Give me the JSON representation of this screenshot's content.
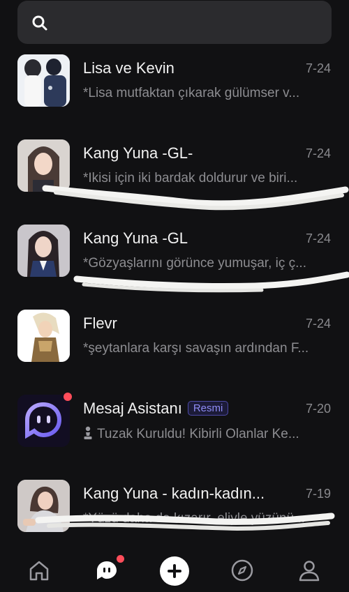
{
  "search": {
    "icon": "search-icon"
  },
  "conversations": [
    {
      "name": "Lisa ve Kevin",
      "date": "7-24",
      "preview": "*Lisa mutfaktan çıkarak gülümser v..."
    },
    {
      "name": "Kang Yuna -GL-",
      "date": "7-24",
      "preview": "*Ikisi için iki bardak doldurur ve biri..."
    },
    {
      "name": "Kang Yuna -GL",
      "date": "7-24",
      "preview": "*Gözyaşlarını görünce yumuşar, iç ç..."
    },
    {
      "name": "Flevr",
      "date": "7-24",
      "preview": "*şeytanlara karşı savaşın ardından F..."
    },
    {
      "name": "Mesaj Asistanı",
      "badge": "Resmi",
      "date": "7-20",
      "preview_icon": "chess-pawn-icon",
      "preview": "Tuzak Kuruldu! Kibirli Olanlar Ke..."
    },
    {
      "name": "Kang Yuna - kadın-kadın...",
      "date": "7-19",
      "preview": "*Yüzü daha da kızarır, eliyle yüzünü..."
    }
  ],
  "tabbar": {
    "items": [
      "home-icon",
      "chat-icon",
      "create-icon",
      "explore-icon",
      "profile-icon"
    ],
    "active": "chat-icon"
  },
  "colors": {
    "background": "#111113",
    "accent_badge": "#8f8cf5",
    "notification": "#ff4d5a"
  }
}
